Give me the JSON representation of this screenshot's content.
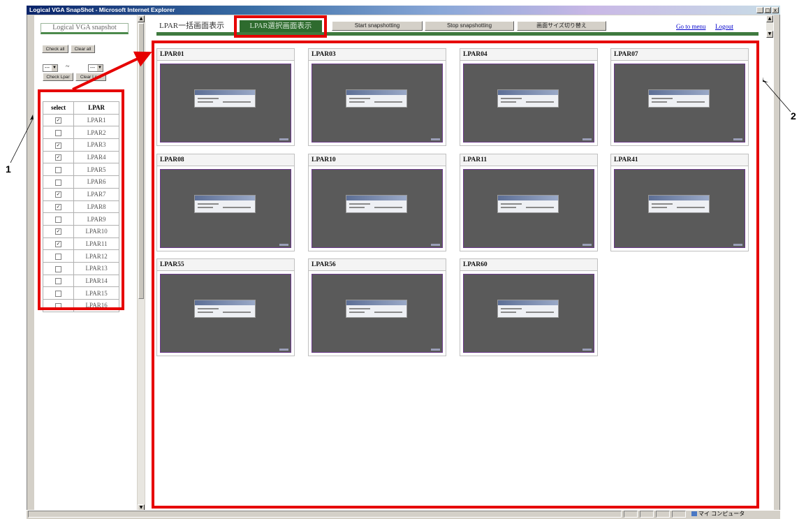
{
  "window": {
    "title": "Logical VGA SnapShot - Microsoft Internet Explorer",
    "buttons": {
      "minimize": "_",
      "maximize": "□",
      "close": "x"
    }
  },
  "sidebar": {
    "title": "Logical VGA snapshot",
    "check_all": "Check all",
    "clear_all": "Clear all",
    "range_from": "---",
    "range_to": "---",
    "range_sep": "~",
    "check_lpar": "Check Lpar",
    "clear_lpar": "Clear Lpar",
    "table": {
      "headers": [
        "select",
        "LPAR"
      ],
      "rows": [
        {
          "name": "LPAR1",
          "checked": true
        },
        {
          "name": "LPAR2",
          "checked": false
        },
        {
          "name": "LPAR3",
          "checked": true
        },
        {
          "name": "LPAR4",
          "checked": true
        },
        {
          "name": "LPAR5",
          "checked": false
        },
        {
          "name": "LPAR6",
          "checked": false
        },
        {
          "name": "LPAR7",
          "checked": true
        },
        {
          "name": "LPAR8",
          "checked": true
        },
        {
          "name": "LPAR9",
          "checked": false
        },
        {
          "name": "LPAR10",
          "checked": true
        },
        {
          "name": "LPAR11",
          "checked": true
        },
        {
          "name": "LPAR12",
          "checked": false
        },
        {
          "name": "LPAR13",
          "checked": false
        },
        {
          "name": "LPAR14",
          "checked": false
        },
        {
          "name": "LPAR15",
          "checked": false
        },
        {
          "name": "LPAR16",
          "checked": false
        }
      ]
    }
  },
  "toolbar": {
    "tab_batch": "LPAR一括画面表示",
    "tab_select": "LPAR選択画面表示",
    "start": "Start snapshotting",
    "stop": "Stop snapshotting",
    "resize": "画面サイズ切り替え",
    "go_to_menu": "Go to menu",
    "logout": "Logout"
  },
  "thumbnails": [
    "LPAR01",
    "LPAR03",
    "LPAR04",
    "LPAR07",
    "LPAR08",
    "LPAR10",
    "LPAR11",
    "LPAR41",
    "LPAR55",
    "LPAR56",
    "LPAR60"
  ],
  "callouts": {
    "one": "1",
    "two": "2"
  },
  "statusbar": {
    "text": "マイ コンピュータ"
  },
  "colors": {
    "annotation": "#e60000",
    "tab_active": "#2e6b2e",
    "title_bar": "#0a246a"
  }
}
